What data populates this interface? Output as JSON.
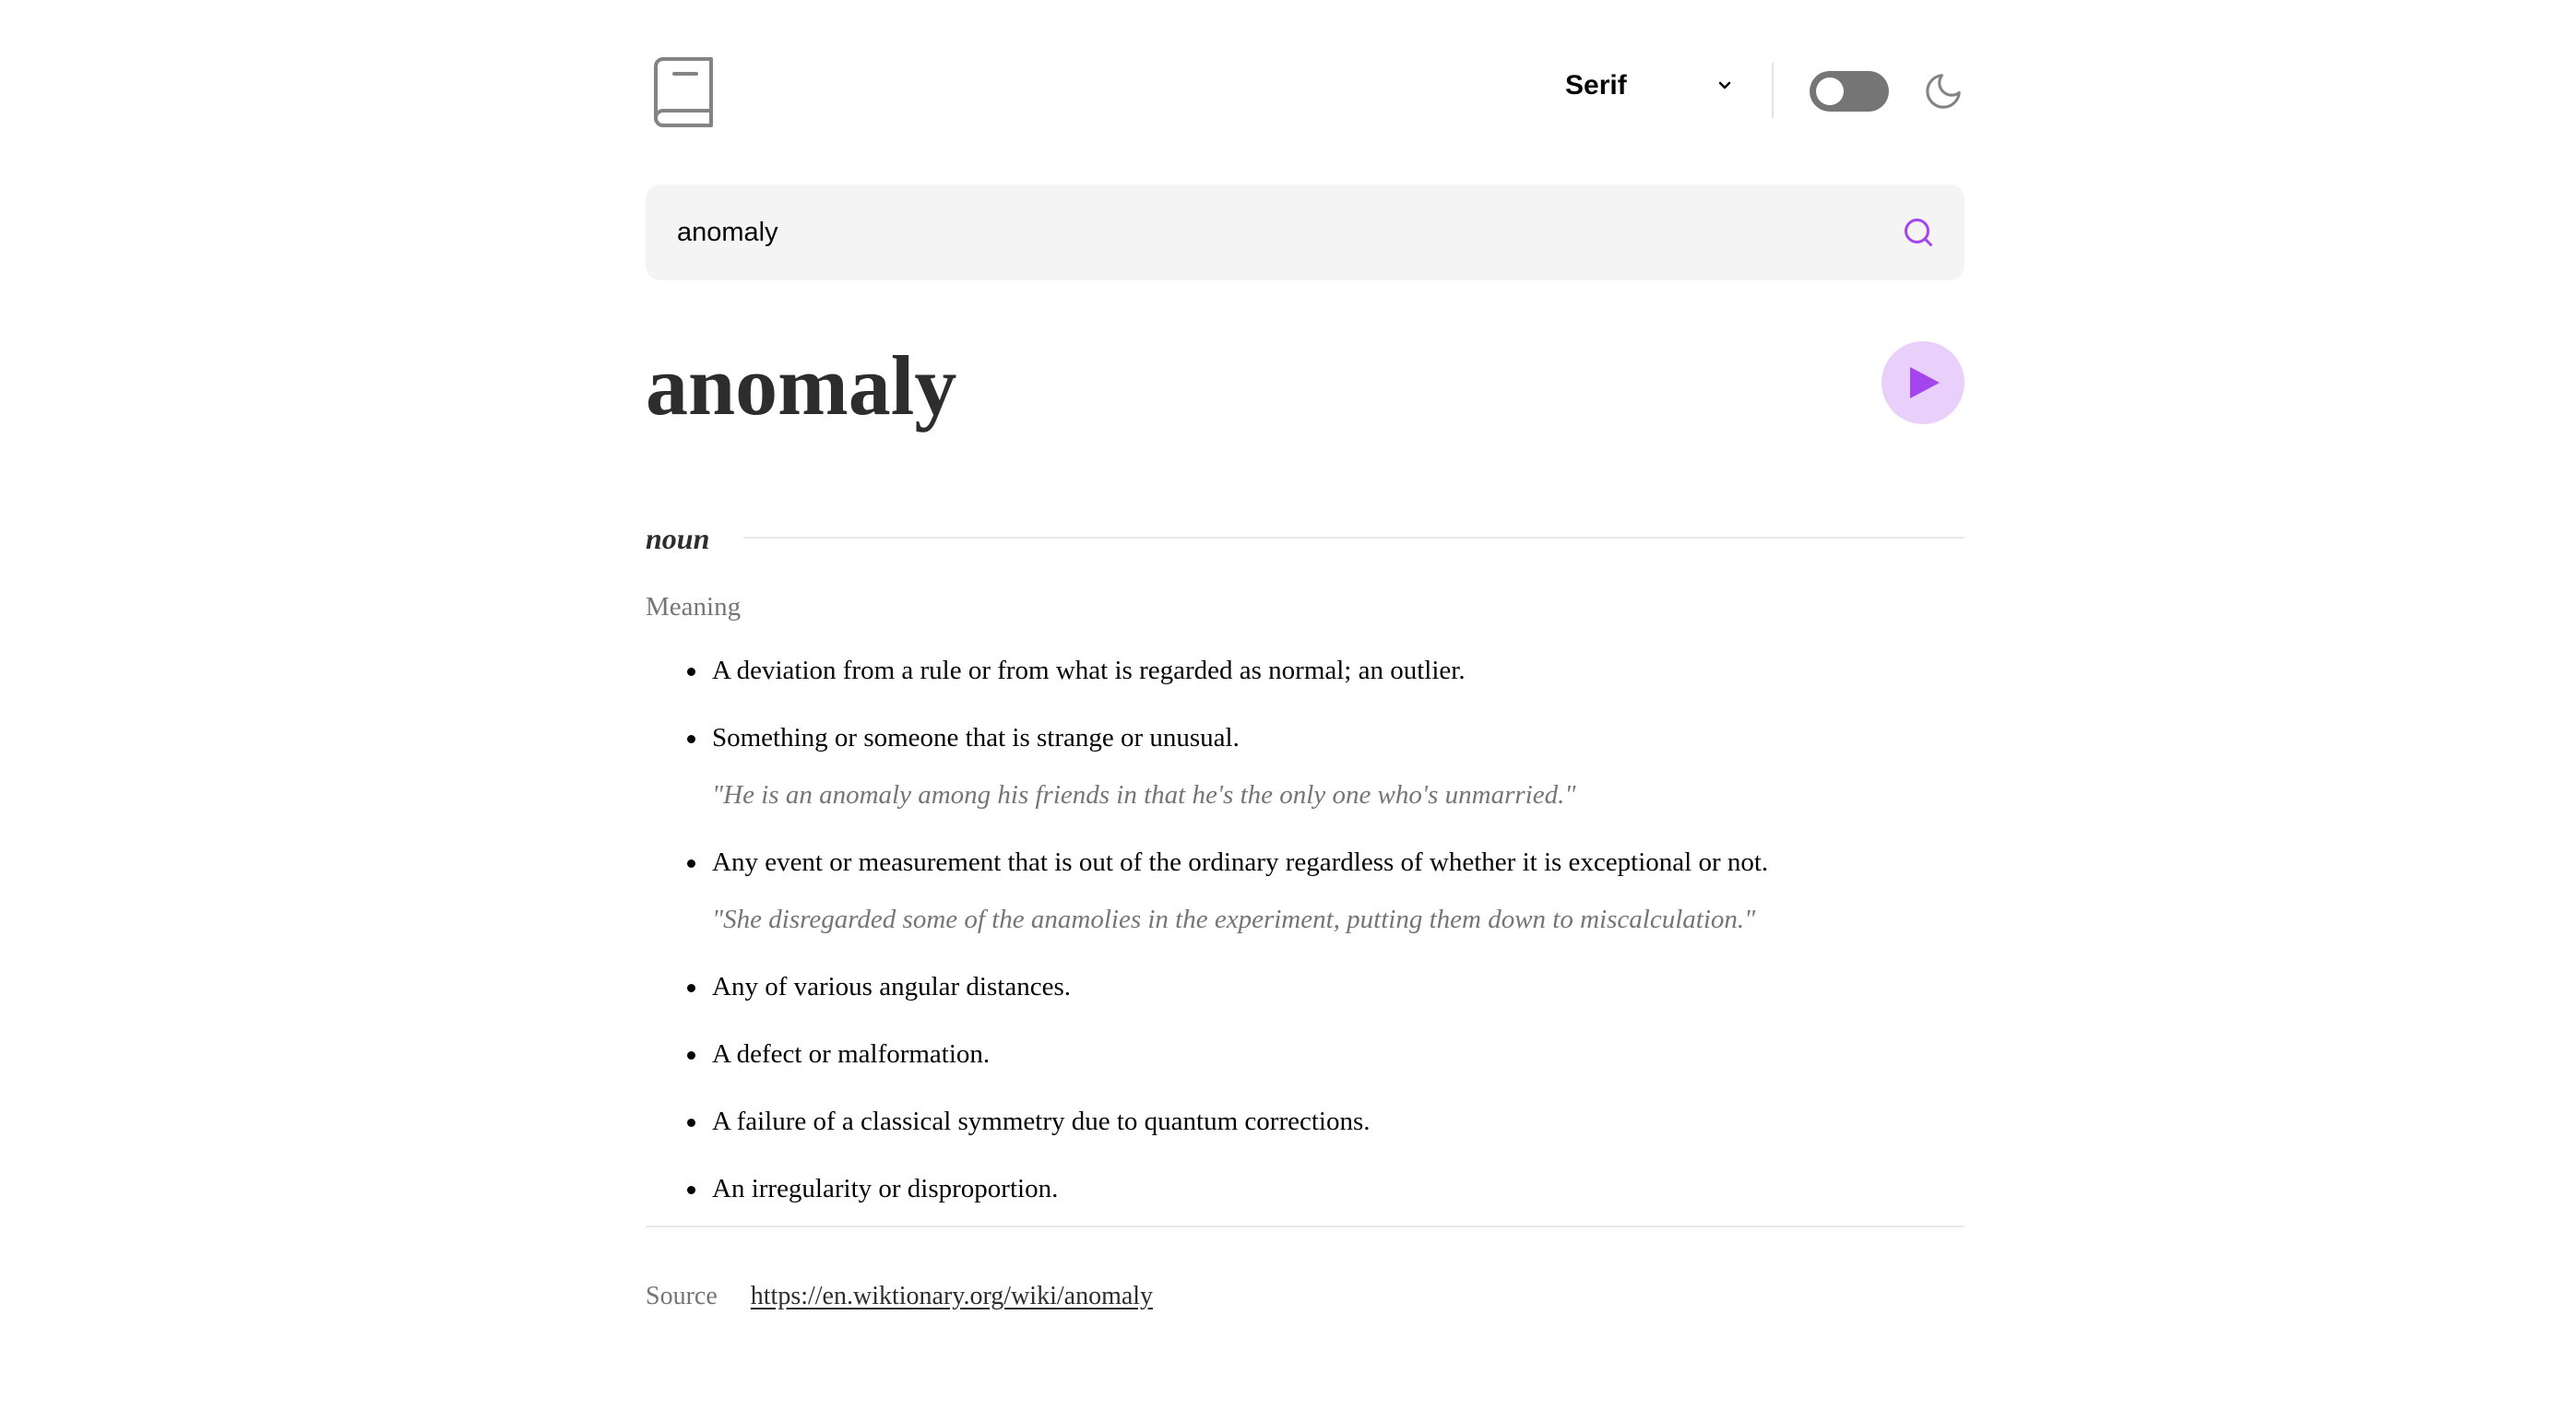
{
  "header": {
    "logo_icon": "book-icon",
    "font_select": {
      "selected": "Serif",
      "icon": "chevron-down-icon"
    },
    "theme_toggle": {
      "state": "off",
      "icon": "moon-icon"
    }
  },
  "search": {
    "value": "anomaly",
    "icon": "search-icon"
  },
  "word": {
    "title": "anomaly",
    "play_icon": "play-icon"
  },
  "meaning_block": {
    "part_of_speech": "noun",
    "heading": "Meaning",
    "definitions": [
      {
        "text": "A deviation from a rule or from what is regarded as normal; an outlier.",
        "example": ""
      },
      {
        "text": "Something or someone that is strange or unusual.",
        "example": "\"He is an anomaly among his friends in that he's the only one who's unmarried.\""
      },
      {
        "text": "Any event or measurement that is out of the ordinary regardless of whether it is exceptional or not.",
        "example": "\"She disregarded some of the anamolies in the experiment, putting them down to miscalculation.\""
      },
      {
        "text": "Any of various angular distances.",
        "example": ""
      },
      {
        "text": "A defect or malformation.",
        "example": ""
      },
      {
        "text": "A failure of a classical symmetry due to quantum corrections.",
        "example": ""
      },
      {
        "text": "An irregularity or disproportion.",
        "example": ""
      }
    ]
  },
  "source": {
    "label": "Source",
    "url": "https://en.wiktionary.org/wiki/anomaly"
  },
  "colors": {
    "accent": "#a445ed",
    "accent_light": "#e9d0fa",
    "text": "#050505",
    "muted": "#757575",
    "search_bg": "#f4f4f4",
    "toggle_bg": "#757575"
  }
}
